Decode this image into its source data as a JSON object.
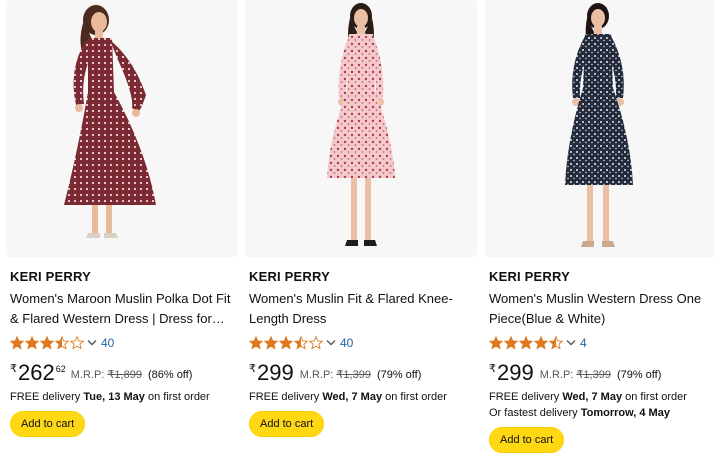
{
  "products": [
    {
      "brand": "KERI PERRY",
      "title": "Women's Maroon Muslin Polka Dot Fit & Flared Western Dress | Dress for…",
      "rating_stars": 3.5,
      "rating_count": "40",
      "currency": "₹",
      "price_whole": "262",
      "price_fraction": "62",
      "mrp_label": "M.R.P:",
      "mrp_value": "₹1,899",
      "discount": "(86% off)",
      "delivery_prefix": "FREE delivery",
      "delivery_date": "Tue, 13 May",
      "delivery_suffix": "on first order",
      "fastest_prefix": "",
      "fastest_date": "",
      "cta": "Add to cart",
      "image_icon": "maroon-dress-image",
      "dress_color": "#7b2a33",
      "dot_color": "#f2d6d6"
    },
    {
      "brand": "KERI PERRY",
      "title": "Women's Muslin Fit & Flared Knee-Length Dress",
      "rating_stars": 3.5,
      "rating_count": "40",
      "currency": "₹",
      "price_whole": "299",
      "price_fraction": "",
      "mrp_label": "M.R.P:",
      "mrp_value": "₹1,399",
      "discount": "(79% off)",
      "delivery_prefix": "FREE delivery",
      "delivery_date": "Wed, 7 May",
      "delivery_suffix": "on first order",
      "fastest_prefix": "",
      "fastest_date": "",
      "cta": "Add to cart",
      "image_icon": "pink-floral-dress-image",
      "dress_color": "#f3c9cc",
      "dot_color": "#b43c4c"
    },
    {
      "brand": "KERI PERRY",
      "title": "Women's Muslin Western Dress One Piece(Blue & White)",
      "rating_stars": 4.5,
      "rating_count": "4",
      "currency": "₹",
      "price_whole": "299",
      "price_fraction": "",
      "mrp_label": "M.R.P:",
      "mrp_value": "₹1,399",
      "discount": "(79% off)",
      "delivery_prefix": "FREE delivery",
      "delivery_date": "Wed, 7 May",
      "delivery_suffix": "on first order",
      "fastest_prefix": "Or fastest delivery",
      "fastest_date": "Tomorrow, 4 May",
      "cta": "Add to cart",
      "image_icon": "navy-print-dress-image",
      "dress_color": "#232b3c",
      "dot_color": "#e9ecf2"
    }
  ],
  "colors": {
    "star": "#de7921",
    "link": "#2162a1",
    "button": "#ffd814"
  }
}
